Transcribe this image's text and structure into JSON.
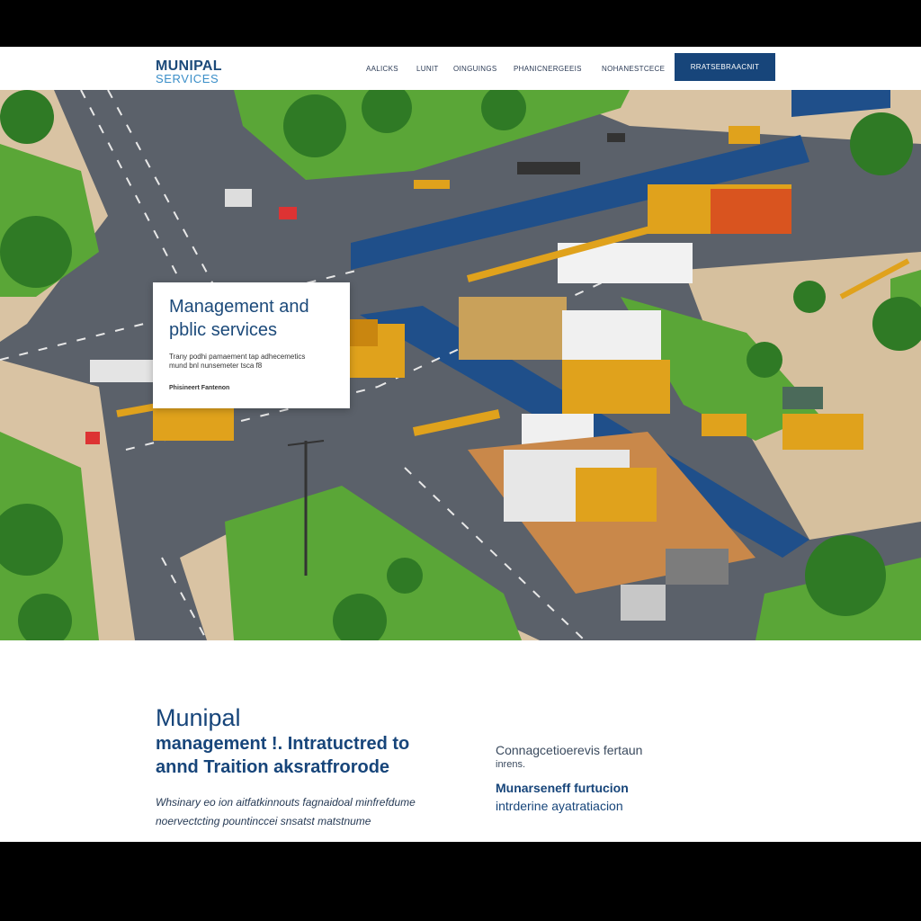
{
  "header": {
    "logo_main": "MUNIPAL",
    "logo_sub": "SERVICES",
    "nav": [
      "AALICKS",
      "LUNIT",
      "OINGUINGS",
      "PHANICNERGEEIS",
      "NOHANESTCECE"
    ],
    "cta_label": "RRATSEBRAACNIT"
  },
  "hero_card": {
    "title_line1": "Management and",
    "title_line2": "pblic services",
    "text_line1": "Trany podhi pamaement tap adhecemetics",
    "text_line2": "mund bnl nunsemeter tsca f8",
    "meta": "Phisineert Fantenon"
  },
  "main": {
    "heading_line1": "Munipal",
    "heading_line2": "management !. Intratuctred to",
    "heading_line3": "annd Traition aksratfrorode",
    "desc_line1": "Whsinary eo ion aitfatkinnouts fagnaidoal minfrefdume",
    "desc_line2": "noervectcting pountinccei snsatst matstnume"
  },
  "side": {
    "title": "Connagcetioerevis fertaun",
    "sub": "inrens.",
    "strong_line1": "Munarseneff furtucion",
    "strong_line2": "intrderine ayatratiacion"
  },
  "colors": {
    "brand_blue": "#17457a",
    "accent_blue": "#3a8ec8",
    "road": "#5b616a",
    "grass": "#5aa637",
    "machine_yellow": "#e0a21c"
  }
}
